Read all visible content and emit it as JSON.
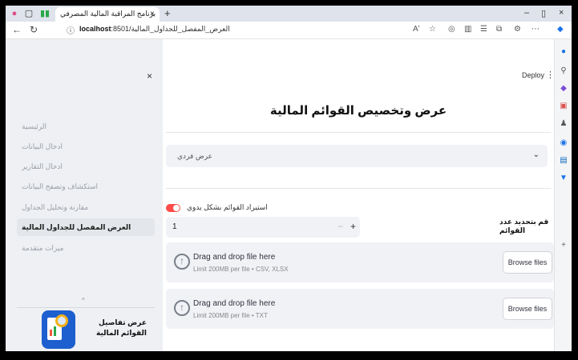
{
  "browser": {
    "tab_title": "برنامج المراقبة المالية المصرفي",
    "url_host": "localhost",
    "url_rest": ":8501/العرض_المفصل_للجداول_المالية",
    "read_aloud_label": "Aʹ"
  },
  "header": {
    "deploy_label": "Deploy"
  },
  "sidebar": {
    "items": [
      {
        "label": "الرئيسية",
        "active": false
      },
      {
        "label": "ادخال البيانات",
        "active": false
      },
      {
        "label": "ادخال التقارير",
        "active": false
      },
      {
        "label": "استكشاف وتصفح البيانات",
        "active": false
      },
      {
        "label": "مقارنة وتحليل الجداول",
        "active": false
      },
      {
        "label": "العرض المفصل للجداول المالية",
        "active": true
      },
      {
        "label": "ميزات متقدمة",
        "active": false
      }
    ],
    "caption": "عرض تفاصيل القوائم المالية"
  },
  "main": {
    "title": "عرض وتخصيص القوائم المالية",
    "view_select": "عرض فردي",
    "toggle_label": "استيراد القوائم بشكل يدوي",
    "number_label": "قم بتحديد عدد القوائم",
    "number_value": "1",
    "uploads": [
      {
        "heading": "Drag and drop file here",
        "sub": "Limit 200MB per file • CSV, XLSX",
        "button": "Browse files"
      },
      {
        "heading": "Drag and drop file here",
        "sub": "Limit 200MB per file • TXT",
        "button": "Browse files"
      }
    ]
  },
  "colors": {
    "accent": "#ff4b4b",
    "sidebar_bg": "#eef0f3",
    "input_bg": "#f0f2f6"
  }
}
